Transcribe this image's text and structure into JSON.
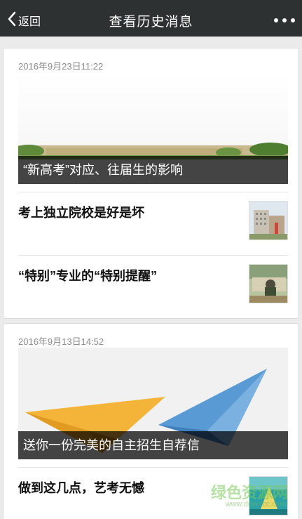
{
  "navbar": {
    "back_label": "返回",
    "title": "查看历史消息"
  },
  "cards": [
    {
      "date": "2016年9月23日11:22",
      "cover_caption": "“新高考”对应、往届生的影响",
      "articles": [
        {
          "title": "考上独立院校是好是坏"
        },
        {
          "title": "“特别”专业的“特别提醒”"
        }
      ]
    },
    {
      "date": "2016年9月13日14:52",
      "cover_caption": "送你一份完美的自主招生自荐信",
      "articles": [
        {
          "title": "做到这几点，艺考无憾"
        }
      ]
    }
  ],
  "watermark": {
    "text": "绿色资源网",
    "url": "www.downcc.com"
  }
}
